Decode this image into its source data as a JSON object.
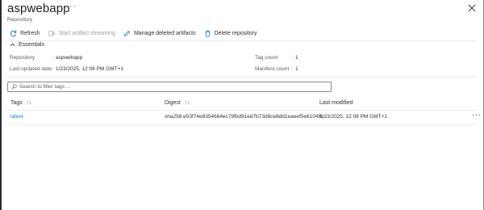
{
  "header": {
    "title": "aspwebapp",
    "subtitle": "Repository",
    "more": "···"
  },
  "toolbar": {
    "refresh": "Refresh",
    "start_streaming": "Start artifact streaming",
    "manage_deleted": "Manage deleted artifacts",
    "delete_repo": "Delete repository"
  },
  "essentials": {
    "heading": "Essentials",
    "repository_label": "Repository",
    "repository_value": "aspwebapp",
    "updated_label": "Last updated date",
    "updated_value": "1/23/2025, 12:08 PM GMT+1",
    "tag_count_label": "Tag count",
    "tag_count_value": "1",
    "manifest_count_label": "Manifest count",
    "manifest_count_value": "1"
  },
  "filter": {
    "placeholder": "Search to filter tags ..."
  },
  "table": {
    "columns": {
      "tags": "Tags",
      "digest": "Digest",
      "last_modified": "Last modified",
      "sort_glyph": "↑↓"
    },
    "rows": [
      {
        "tag": "latest",
        "digest": "sha256:e53f74e8354664ec79fbd91ed7b73d8ce8dd1eaeef5e6104f6...",
        "last_modified": "1/23/2025, 12:08 PM GMT+1",
        "more": "···"
      }
    ]
  },
  "colors": {
    "link": "#0078d4",
    "text": "#323130",
    "muted": "#605e5c",
    "disabled": "#a19f9d"
  }
}
